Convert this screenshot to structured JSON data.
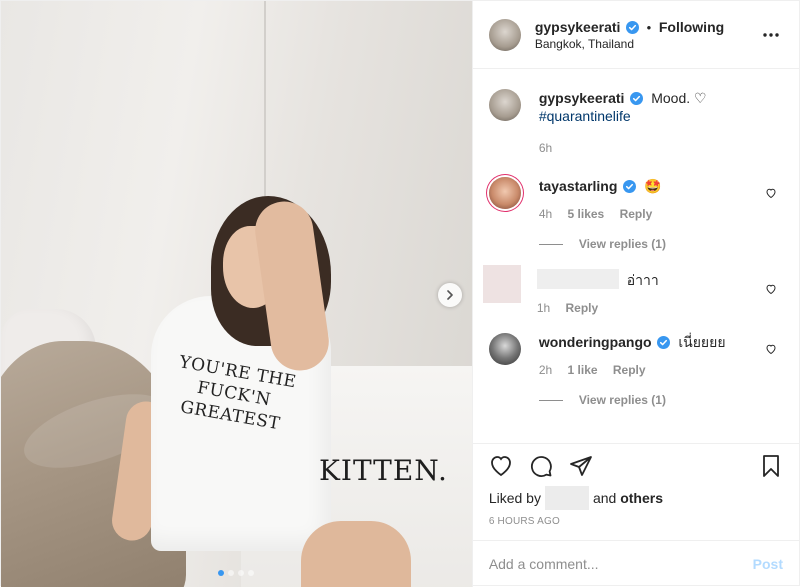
{
  "post": {
    "author": "gypsykeerati",
    "follow_status": "Following",
    "separator": "•",
    "location": "Bangkok, Thailand",
    "caption_text": "Mood. ♡",
    "caption_hashtag": "#quarantinelife",
    "caption_time": "6h",
    "photo_text_shirt": "YOU'RE THE FUCK'N GREATEST",
    "photo_text_kitten": "KITTEN.",
    "carousel_count": 4,
    "carousel_active": 1
  },
  "comments": [
    {
      "user": "tayastarling",
      "text": "🤩",
      "time": "4h",
      "likes": "5 likes",
      "reply": "Reply",
      "view_replies": "View replies (1)"
    },
    {
      "user": "",
      "text": "อ่าาา",
      "time": "1h",
      "reply": "Reply"
    },
    {
      "user": "wonderingpango",
      "text": "เนี่ยยยย",
      "time": "2h",
      "likes": "1 like",
      "reply": "Reply",
      "view_replies": "View replies (1)"
    }
  ],
  "footer": {
    "liked_by_prefix": "Liked by",
    "liked_by_and": "and",
    "liked_by_others": "others",
    "timestamp": "6 HOURS AGO",
    "comment_placeholder": "Add a comment...",
    "post_label": "Post"
  },
  "colors": {
    "verified": "#3897f0",
    "link": "#00376b",
    "muted": "#8e8e8e",
    "post_disabled": "#b3dbff"
  },
  "icons": [
    "verified-badge-icon",
    "more-options-icon",
    "heart-icon",
    "comment-icon",
    "share-icon",
    "bookmark-icon",
    "chevron-right-icon"
  ]
}
